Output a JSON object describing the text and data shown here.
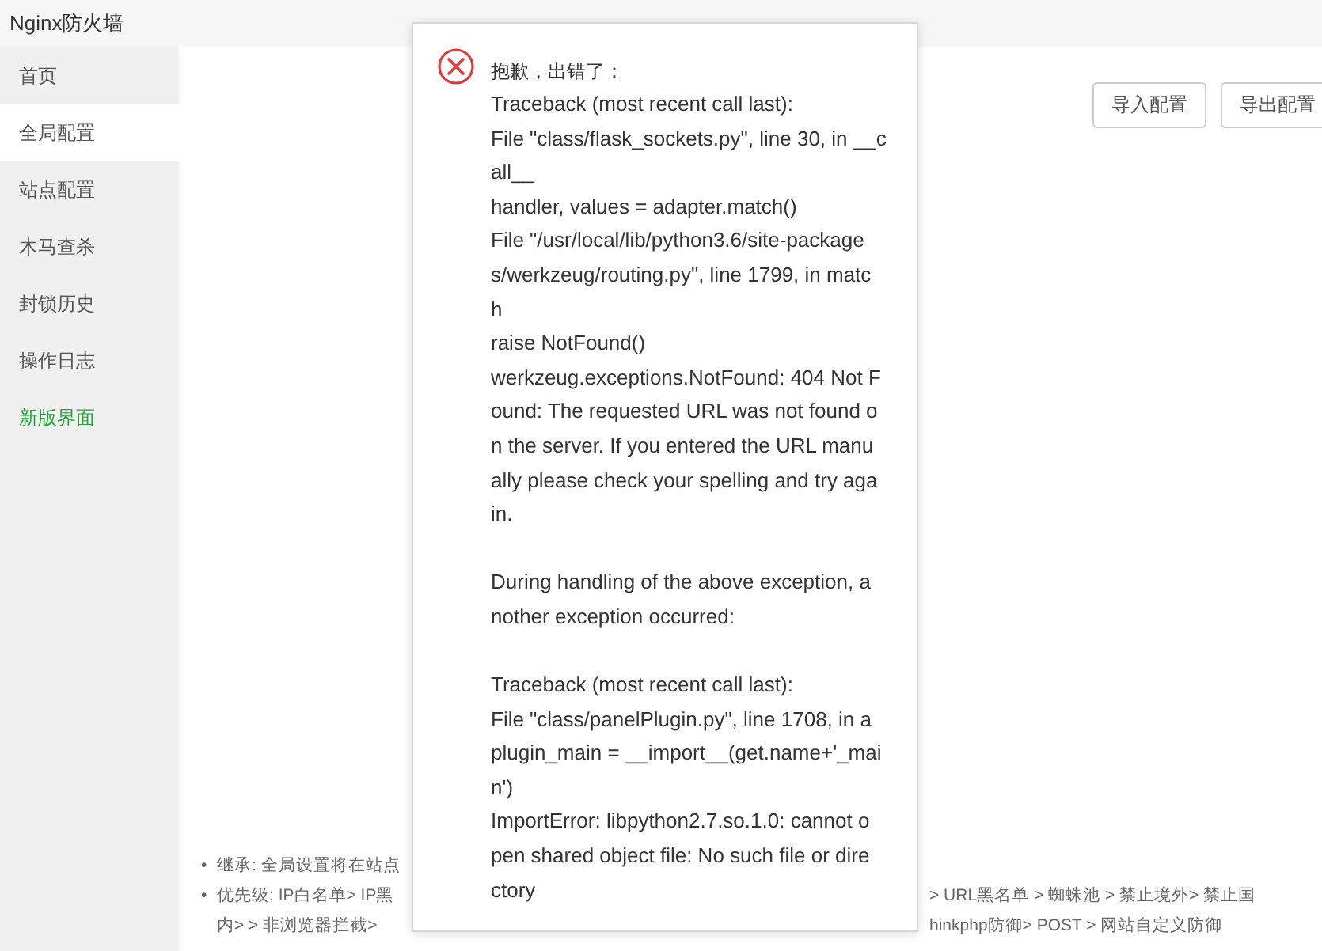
{
  "header": {
    "title": "Nginx防火墙"
  },
  "sidebar": {
    "items": [
      {
        "label": "首页",
        "selected": false,
        "kind": "normal"
      },
      {
        "label": "全局配置",
        "selected": true,
        "kind": "normal"
      },
      {
        "label": "站点配置",
        "selected": false,
        "kind": "normal"
      },
      {
        "label": "木马查杀",
        "selected": false,
        "kind": "normal"
      },
      {
        "label": "封锁历史",
        "selected": false,
        "kind": "normal"
      },
      {
        "label": "操作日志",
        "selected": false,
        "kind": "normal"
      },
      {
        "label": "新版界面",
        "selected": false,
        "kind": "highlight"
      }
    ]
  },
  "buttons": [
    "导入配置",
    "导出配置"
  ],
  "notes": [
    {
      "marker": "•",
      "lines": [
        [
          "继承: 全局设置将在站点"
        ]
      ]
    },
    {
      "marker": "•",
      "lines": [
        [
          "优先级: IP白名单> IP黑",
          "> URL黑名单 > 蜘蛛池 > 禁止境外> 禁止国"
        ],
        [
          "内> > 非浏览器拦截> ",
          "hinkphp防御> POST > 网站自定义防御"
        ]
      ]
    }
  ],
  "error_dialog": {
    "title": "抱歉，出错了：",
    "paragraphs": [
      [
        "Traceback (most recent call last):",
        "File \"class/flask_sockets.py\", line 30, in __c",
        "all__",
        "handler, values = adapter.match()",
        "File \"/usr/local/lib/python3.6/site-package",
        "s/werkzeug/routing.py\", line 1799, in matc",
        "h",
        "raise NotFound()",
        "werkzeug.exceptions.NotFound: 404 Not F",
        "ound: The requested URL was not found o",
        "n the server. If you entered the URL manu",
        "ally please check your spelling and try aga",
        "in."
      ],
      [
        "During handling of the above exception, a",
        "nother exception occurred:"
      ],
      [
        "Traceback (most recent call last):",
        "File \"class/panelPlugin.py\", line 1708, in a",
        "plugin_main = __import__(get.name+'_mai",
        "n')",
        "ImportError: libpython2.7.so.1.0: cannot o",
        "pen shared object file: No such file or dire",
        "ctory"
      ]
    ]
  }
}
